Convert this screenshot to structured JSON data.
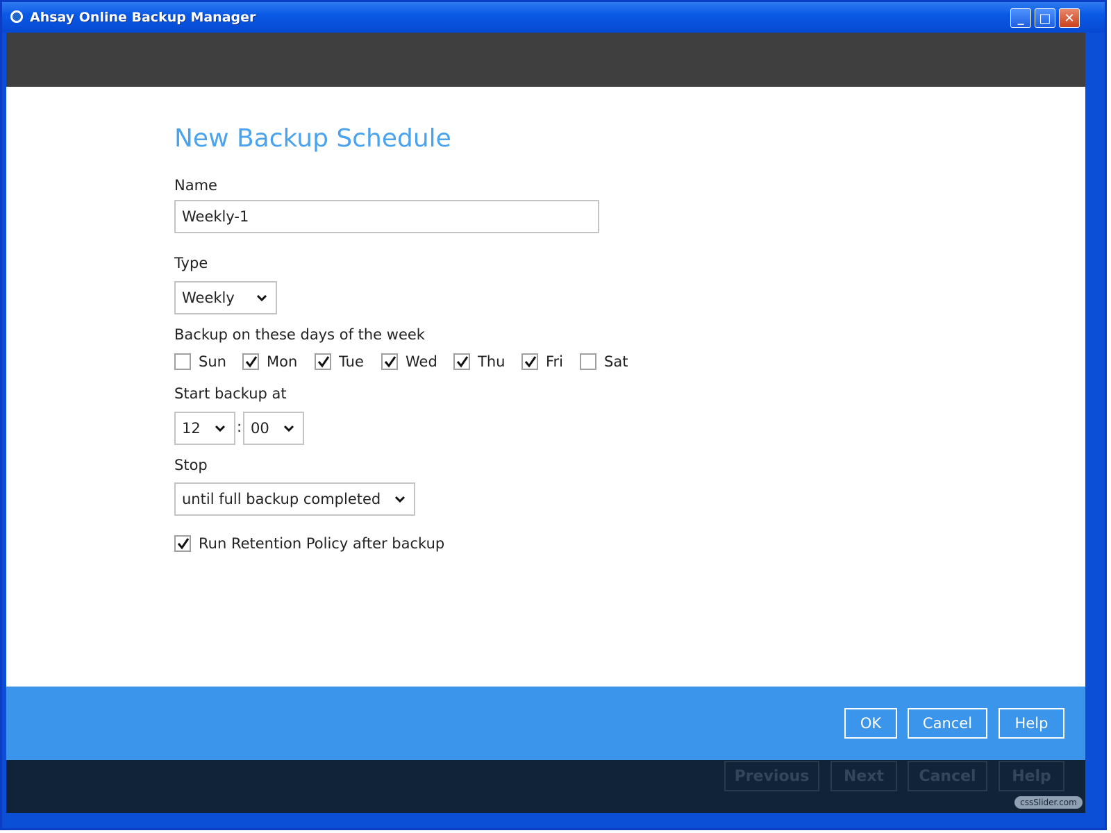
{
  "window": {
    "title": "Ahsay Online Backup Manager",
    "minimize_glyph": "_",
    "maximize_glyph": "□",
    "close_glyph": "✕"
  },
  "form": {
    "title": "New Backup Schedule",
    "name_label": "Name",
    "name_value": "Weekly-1",
    "type_label": "Type",
    "type_value": "Weekly",
    "days_label": "Backup on these days of the week",
    "days": [
      {
        "label": "Sun",
        "checked": false
      },
      {
        "label": "Mon",
        "checked": true
      },
      {
        "label": "Tue",
        "checked": true
      },
      {
        "label": "Wed",
        "checked": true
      },
      {
        "label": "Thu",
        "checked": true
      },
      {
        "label": "Fri",
        "checked": true
      },
      {
        "label": "Sat",
        "checked": false
      }
    ],
    "start_label": "Start backup at",
    "start_hour": "12",
    "time_separator": ":",
    "start_minute": "00",
    "stop_label": "Stop",
    "stop_value": "until full backup completed",
    "retention_label": "Run Retention Policy after backup",
    "retention_checked": true
  },
  "dialog_buttons": {
    "ok": "OK",
    "cancel": "Cancel",
    "help": "Help"
  },
  "wizard_buttons": {
    "previous": "Previous",
    "next": "Next",
    "cancel": "Cancel",
    "help": "Help"
  },
  "watermark": "cssSlider.com",
  "colors": {
    "title_blue": "#4aa3ee",
    "footer_blue": "#3b95ea",
    "footer_dark": "#112339",
    "header_band": "#3f3f3f"
  }
}
